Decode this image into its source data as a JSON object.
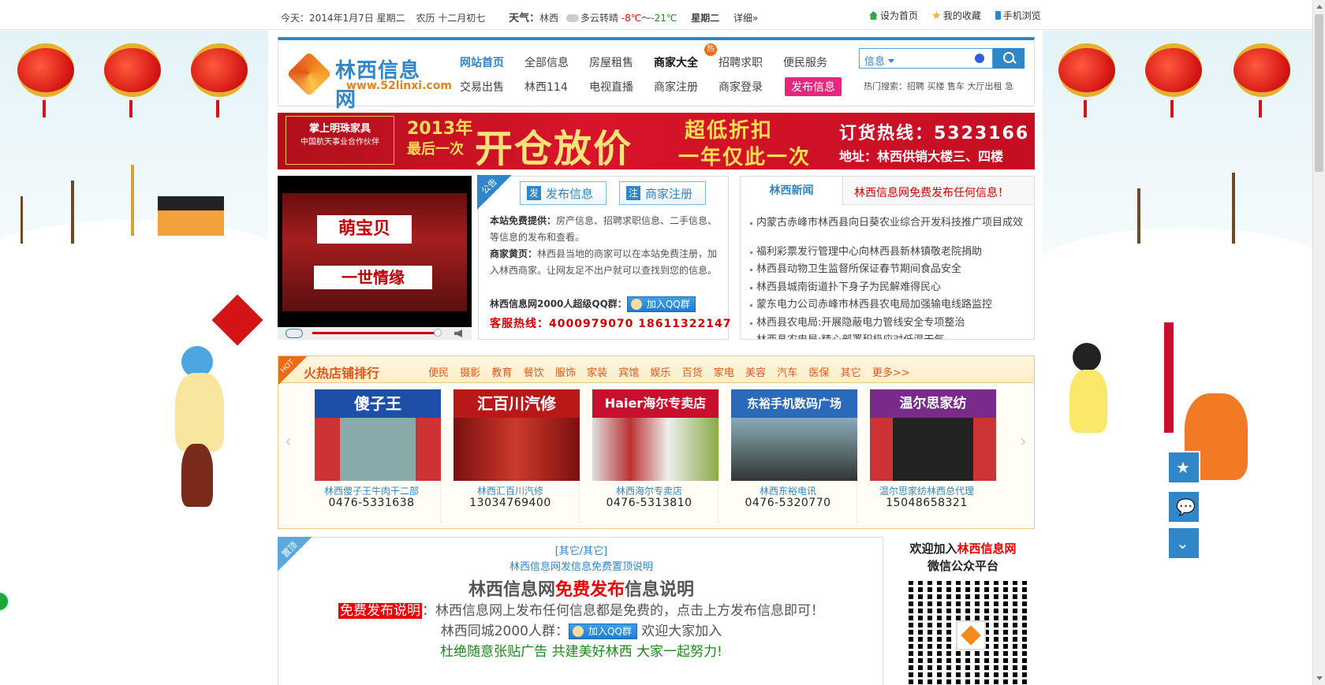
{
  "topbar": {
    "date": "今天：2014年1月7日 星期二",
    "lunar": "农历 十二月初七",
    "weather_label": "天气：",
    "city": "林西",
    "condition": "多云转晴",
    "temp_low": "-8℃",
    "temp_sep": "～",
    "temp_high": "-21℃",
    "weekday": "星期二",
    "detail": "详细»",
    "set_home": "设为首页",
    "favorites": "我的收藏",
    "mobile": "手机浏览"
  },
  "logo": {
    "name": "林西信息网",
    "url": "www.52linxi.com"
  },
  "nav": {
    "items": [
      {
        "label": "网站首页"
      },
      {
        "label": "全部信息"
      },
      {
        "label": "房屋租售"
      },
      {
        "label": "商家大全"
      },
      {
        "label": "招聘求职"
      },
      {
        "label": "便民服务"
      },
      {
        "label": "交易出售"
      },
      {
        "label": "林西114"
      },
      {
        "label": "电视直播"
      },
      {
        "label": "商家注册"
      },
      {
        "label": "商家登录"
      },
      {
        "label": "发布信息"
      }
    ],
    "hot_badge": "热"
  },
  "search": {
    "category": "信息",
    "placeholder": "",
    "hot_label": "热门搜索：",
    "hot_terms": "招聘 买楼 售车 大厅出租 急"
  },
  "banner": {
    "brand": "掌上明珠家具",
    "brand_sub": "中国航天事业合作伙伴",
    "year_line1": "2013年",
    "year_line2": "最后一次",
    "headline": "开仓放价",
    "mid1": "超低折扣",
    "mid2": "一年仅此一次",
    "hotline": "订货热线：5323166",
    "address": "地址：林西供销大楼三、四楼"
  },
  "video": {
    "sign1": "萌宝贝",
    "sign2": "一世情缘"
  },
  "notice": {
    "tag": "公告",
    "publish_btn": "发布信息",
    "register_btn": "商家注册",
    "p1_label": "本站免费提供：",
    "p1_text": "房产信息、招聘求职信息、二手信息、等信息的发布和查看。",
    "p2_label": "商家黄页：",
    "p2_text": "林西县当地的商家可以在本站免费注册，加入林西商家。让网友足不出户就可以查找到您的信息。",
    "qq_label": "林西信息网2000人超级QQ群：",
    "qq_btn": "加入QQ群",
    "hotline_label": "客服热线：",
    "hotline": "4000979070  18611322147"
  },
  "news": {
    "tab_active": "林西新闻",
    "tab_other": "林西信息网免费发布任何信息！",
    "items": [
      "内蒙古赤峰市林西县向日葵农业综合开发科技推广项目成效",
      "福利彩票发行管理中心向林西县新林镇敬老院捐助",
      "林西县动物卫生监督所保证春节期间食品安全",
      "林西县城南街道扑下身子为民解难得民心",
      "蒙东电力公司赤峰市林西县农电局加强输电线路监控",
      "林西县农电局:开展隐蔽电力管线安全专项整治",
      "林西县农电局:精心部署积极应对低温天气"
    ]
  },
  "shops": {
    "hot_tag": "HOT",
    "title": "火热店铺排行",
    "categories": [
      "便民",
      "摄影",
      "教育",
      "餐饮",
      "服饰",
      "家装",
      "宾馆",
      "娱乐",
      "百货",
      "家电",
      "美容",
      "汽车",
      "医保",
      "其它",
      "更多>>"
    ],
    "items": [
      {
        "sign": "傻子王",
        "name": "林西傻子王牛肉干二部",
        "tel": "0476-5331638"
      },
      {
        "sign": "汇百川汽修",
        "name": "林西汇百川汽修",
        "tel": "13034769400"
      },
      {
        "sign": "Haier海尔专卖店",
        "name": "林西海尔专卖店",
        "tel": "0476-5313810"
      },
      {
        "sign": "东裕手机数码广场",
        "name": "林西东裕电讯",
        "tel": "0476-5320770"
      },
      {
        "sign": "温尔思家纺",
        "name": "温尔思家纺林西总代理",
        "tel": "15048658321"
      }
    ]
  },
  "top_notice": {
    "tag": "置顶",
    "category": "[其它/其它]",
    "subtitle": "林西信息网发信息免费置顶说明",
    "heading_pre": "林西信息网",
    "heading_red": "免费发布",
    "heading_post": "信息说明",
    "line1_tag": "免费发布说明",
    "line1_text": "：林西信息网上发布任何信息都是免费的，点击上方发布信息即可！",
    "line2_pre": "林西同城2000人群：",
    "line2_btn": "加入QQ群",
    "line2_post": " 欢迎大家加入",
    "line3": "杜绝随意张贴广告  共建美好林西  大家一起努力!"
  },
  "weixin": {
    "line1_pre": "欢迎加入",
    "line1_red": "林西信息网",
    "line2": "微信公众平台"
  },
  "colors": {
    "accent": "#2f86c8",
    "red": "#d40000",
    "orange": "#e2561c",
    "pink": "#e7267d"
  }
}
